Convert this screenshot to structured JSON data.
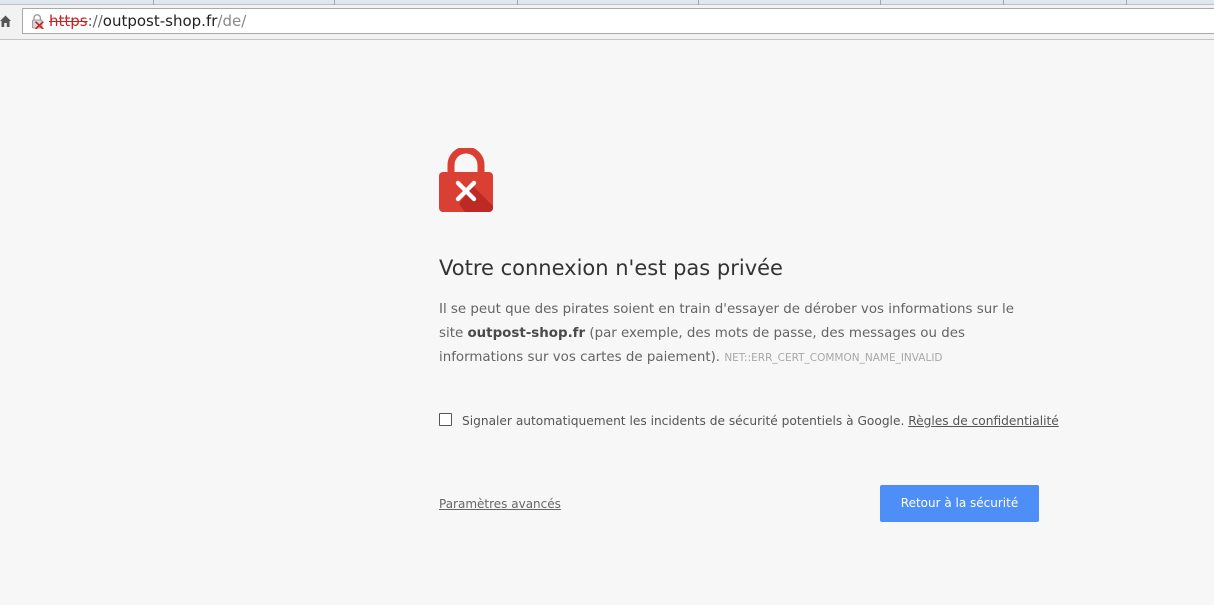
{
  "browser": {
    "url": {
      "scheme": "https",
      "separator": "://",
      "host": "outpost-shop.fr",
      "path": "/de/"
    },
    "icons": {
      "home": "home-icon",
      "security": "broken-lock-icon"
    }
  },
  "interstitial": {
    "icon": "red-padlock-x-icon",
    "heading": "Votre connexion n'est pas privée",
    "explanation": {
      "before_site": "Il se peut que des pirates soient en train d'essayer de dérober vos informations sur le site ",
      "site": "outpost-shop.fr",
      "after_site": " (par exemple, des mots de passe, des messages ou des informations sur vos cartes de paiement). ",
      "error_code": "NET::ERR_CERT_COMMON_NAME_INVALID"
    },
    "report": {
      "checked": false,
      "label": "Signaler automatiquement les incidents de sécurité potentiels à Google. ",
      "privacy_link": "Règles de confidentialité"
    },
    "advanced_link": "Paramètres avancés",
    "back_button": "Retour à la sécurité"
  },
  "colors": {
    "page_background": "#f7f7f7",
    "error_red": "#d93f33",
    "button_blue": "#4d8ef7"
  }
}
